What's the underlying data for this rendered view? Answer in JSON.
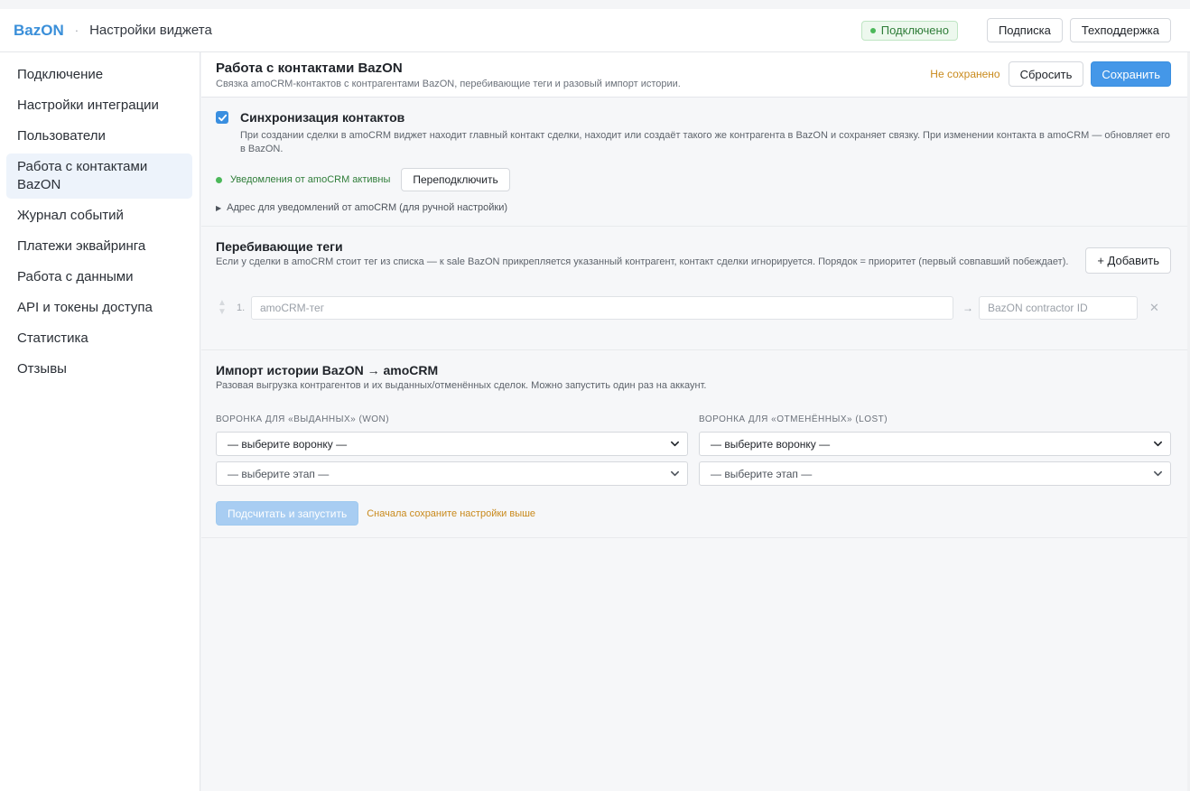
{
  "header": {
    "brand": "BazON",
    "separator": "·",
    "title": "Настройки виджета",
    "status_badge": "Подключено",
    "subscription_label": "Подписка",
    "support_label": "Техподдержка"
  },
  "sidebar": {
    "items": [
      {
        "label": "Подключение",
        "active": false
      },
      {
        "label": "Настройки интеграции",
        "active": false
      },
      {
        "label": "Пользователи",
        "active": false
      },
      {
        "label": "Работа с контактами BazON",
        "active": true
      },
      {
        "label": "Журнал событий",
        "active": false
      },
      {
        "label": "Платежи эквайринга",
        "active": false
      },
      {
        "label": "Работа с данными",
        "active": false
      },
      {
        "label": "API и токены доступа",
        "active": false
      },
      {
        "label": "Статистика",
        "active": false
      },
      {
        "label": "Отзывы",
        "active": false
      }
    ]
  },
  "page": {
    "title": "Работа с контактами BazON",
    "subtitle": "Связка amoCRM-контактов с контрагентами BazON, перебивающие теги и разовый импорт истории.",
    "unsaved_label": "Не сохранено",
    "reset_label": "Сбросить",
    "save_label": "Сохранить"
  },
  "sync": {
    "checked": true,
    "title": "Синхронизация контактов",
    "description": "При создании сделки в amoCRM виджет находит главный контакт сделки, находит или создаёт такого же контрагента в BazON и сохраняет связку. При изменении контакта в amoCRM — обновляет его в BazON.",
    "notifications_status": "Уведомления от amoCRM активны",
    "reconnect_label": "Переподключить",
    "details_label": "Адрес для уведомлений от amoCRM (для ручной настройки)"
  },
  "tags": {
    "title": "Перебивающие теги",
    "description": "Если у сделки в amoCRM стоит тег из списка — к sale BazON прикрепляется указанный контрагент, контакт сделки игнорируется. Порядок = приоритет (первый совпавший побеждает).",
    "add_label": "+ Добавить",
    "rows": [
      {
        "index": "1.",
        "tag_placeholder": "amoCRM-тег",
        "contractor_placeholder": "BazON contractor ID"
      }
    ]
  },
  "import": {
    "title": "Импорт истории BazON → amoCRM",
    "description": "Разовая выгрузка контрагентов и их выданных/отменённых сделок. Можно запустить один раз на аккаунт.",
    "won_label": "ВОРОНКА ДЛЯ «ВЫДАННЫХ» (WON)",
    "lost_label": "ВОРОНКА ДЛЯ «ОТМЕНЁННЫХ» (LOST)",
    "won_funnel": "— выберите воронку —",
    "won_stage": "— выберите этап —",
    "lost_funnel": "— выберите воронку —",
    "lost_stage": "— выберите этап —",
    "run_label": "Подсчитать и запустить",
    "run_hint": "Сначала сохраните настройки выше"
  },
  "colors": {
    "accent": "#4497e8",
    "brand": "#3a8fd9",
    "success": "#4cb85a",
    "warning": "#c98a1c"
  }
}
